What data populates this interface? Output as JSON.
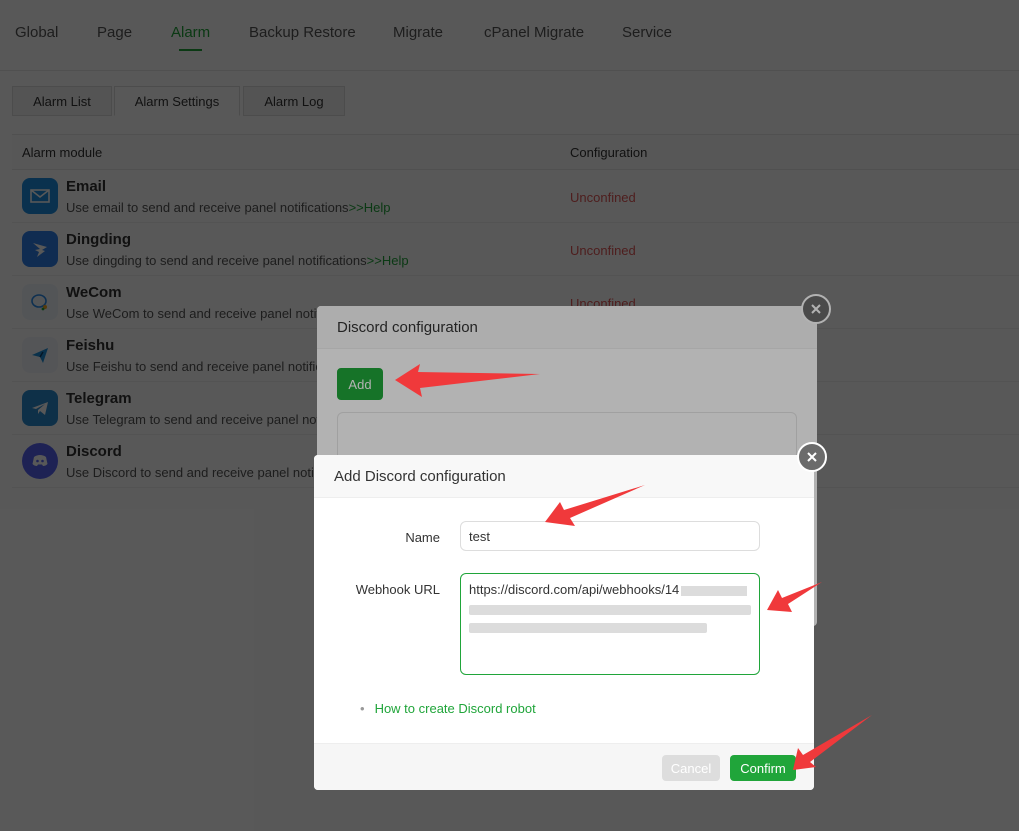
{
  "top_tabs": [
    "Global",
    "Page",
    "Alarm",
    "Backup Restore",
    "Migrate",
    "cPanel Migrate",
    "Service"
  ],
  "active_top_tab": "Alarm",
  "sub_tabs": [
    "Alarm List",
    "Alarm Settings",
    "Alarm Log"
  ],
  "active_sub_tab": "Alarm Settings",
  "table": {
    "headers": [
      "Alarm module",
      "Configuration"
    ],
    "rows": [
      {
        "name": "Email",
        "desc": "Use email to send and receive panel notifications",
        "help": ">>Help",
        "status": "Unconfined",
        "icon": "email-icon"
      },
      {
        "name": "Dingding",
        "desc": "Use dingding to send and receive panel notifications",
        "help": ">>Help",
        "status": "Unconfined",
        "icon": "dingding-icon"
      },
      {
        "name": "WeCom",
        "desc": "Use WeCom to send and receive panel notifi",
        "help": "",
        "status": "Unconfined",
        "icon": "wecom-icon"
      },
      {
        "name": "Feishu",
        "desc": "Use Feishu to send and receive panel notific",
        "help": "",
        "status": "",
        "icon": "feishu-icon"
      },
      {
        "name": "Telegram",
        "desc": "Use Telegram to send and receive panel not",
        "help": "",
        "status": "",
        "icon": "telegram-icon"
      },
      {
        "name": "Discord",
        "desc": "Use Discord to send and receive panel notif",
        "help": "",
        "status": "",
        "icon": "discord-icon"
      }
    ]
  },
  "discord_dialog": {
    "title": "Discord configuration",
    "add_label": "Add"
  },
  "add_dialog": {
    "title": "Add Discord configuration",
    "name_label": "Name",
    "name_value": "test",
    "webhook_label": "Webhook URL",
    "webhook_value": "https://discord.com/api/webhooks/14",
    "help_link": "How to create Discord robot",
    "cancel_label": "Cancel",
    "confirm_label": "Confirm"
  },
  "colors": {
    "accent": "#20a53a",
    "unconfigured": "#e05757",
    "arrow": "#f0393b"
  }
}
